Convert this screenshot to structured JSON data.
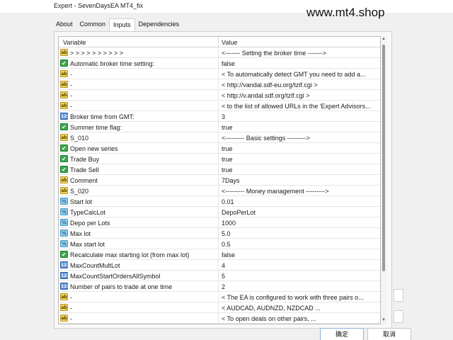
{
  "window": {
    "title": "Expert - SevenDaysEA MT4_fix",
    "watermark": "www.mt4.shop"
  },
  "tabs": [
    {
      "label": "About"
    },
    {
      "label": "Common"
    },
    {
      "label": "Inputs",
      "active": true
    },
    {
      "label": "Dependencies"
    }
  ],
  "grid": {
    "col_variable": "Variable",
    "col_value": "Value",
    "rows": [
      {
        "icon": "ab",
        "variable": ">   >   >   >   >   >   >   >   >   >",
        "value": "<-------          Setting the broker time          ------->"
      },
      {
        "icon": "check",
        "variable": "Automatic broker time setting:",
        "value": "false"
      },
      {
        "icon": "ab",
        "variable": "-",
        "value": "<  To automatically detect GMT you need to add a..."
      },
      {
        "icon": "ab",
        "variable": "-",
        "value": "<              http://vandal.sdf-eu.org/tzif.cgi              >"
      },
      {
        "icon": "ab",
        "variable": "-",
        "value": "<                http://v.andal.sdf.org/tzlf.cgi                >"
      },
      {
        "icon": "ab",
        "variable": "-",
        "value": "< to the list of allowed URLs in the 'Expert Advisors..."
      },
      {
        "icon": "num",
        "variable": "Broker time from GMT:",
        "value": "3"
      },
      {
        "icon": "check",
        "variable": "Summer time flag:",
        "value": "true"
      },
      {
        "icon": "ab",
        "variable": "S_010",
        "value": "<---------  Basic settings   --------->"
      },
      {
        "icon": "check",
        "variable": "Open new series",
        "value": "true"
      },
      {
        "icon": "check",
        "variable": "Trade Buy",
        "value": "true"
      },
      {
        "icon": "check",
        "variable": "Trade Sell",
        "value": "true"
      },
      {
        "icon": "ab",
        "variable": "Comment",
        "value": "7Days"
      },
      {
        "icon": "ab",
        "variable": "S_020",
        "value": "<---------   Money management   --------->"
      },
      {
        "icon": "dbl",
        "variable": "Start lot",
        "value": "0.01"
      },
      {
        "icon": "dbl",
        "variable": "TypeCalcLot",
        "value": "DepoPerLot"
      },
      {
        "icon": "dbl",
        "variable": "Depo per Lots",
        "value": "1000"
      },
      {
        "icon": "dbl",
        "variable": "Max lot",
        "value": "5.0"
      },
      {
        "icon": "dbl",
        "variable": "Max start lot",
        "value": "0.5"
      },
      {
        "icon": "check",
        "variable": "Recalculate max starting lot (from max lot)",
        "value": "false"
      },
      {
        "icon": "num",
        "variable": "MaxCountMultLot",
        "value": "4"
      },
      {
        "icon": "num",
        "variable": "MaxCountStartOrdersAllSymbol",
        "value": "5"
      },
      {
        "icon": "num",
        "variable": "Number of pairs to trade at one time",
        "value": "2"
      },
      {
        "icon": "ab",
        "variable": "-",
        "value": "<      The EA is configured to work with three pairs o..."
      },
      {
        "icon": "ab",
        "variable": "-",
        "value": "<                AUDCAD, AUDNZD, NZDCAD                ..."
      },
      {
        "icon": "ab",
        "variable": "-",
        "value": "<                To open deals on other pairs,                ..."
      }
    ]
  },
  "buttons": {
    "ok": "确定",
    "cancel": "取消"
  },
  "icon_glyphs": {
    "ab": "ab",
    "check": "✔",
    "num": "123",
    "dbl": "½"
  }
}
